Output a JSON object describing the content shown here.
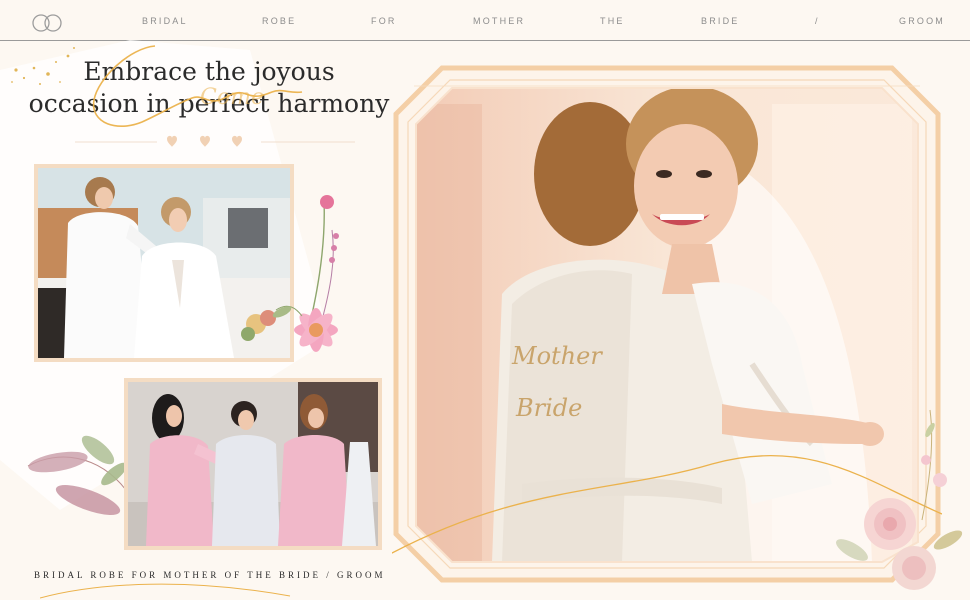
{
  "nav": {
    "items": [
      "BRIDAL",
      "ROBE",
      "FOR",
      "MOTHER",
      "THE",
      "BRIDE",
      "/",
      "GROOM"
    ]
  },
  "heading": {
    "line1": "Embrace the joyous",
    "line2": "occasion in perfect harmony",
    "script_word": "Come"
  },
  "robe_embroidery": {
    "line1": "Mother",
    "line2": "Bride"
  },
  "caption": "BRIDAL ROBE FOR MOTHER OF THE BRIDE / GROOM",
  "colors": {
    "background": "#fdf8f2",
    "frame_peach": "#f4cfa6",
    "gold": "#e8b24a",
    "text": "#2b2b2b",
    "nav_text": "#8d8d8d"
  },
  "icons": [
    "rings-logo-icon",
    "heart-icon",
    "flower-icon",
    "leaf-icon"
  ]
}
